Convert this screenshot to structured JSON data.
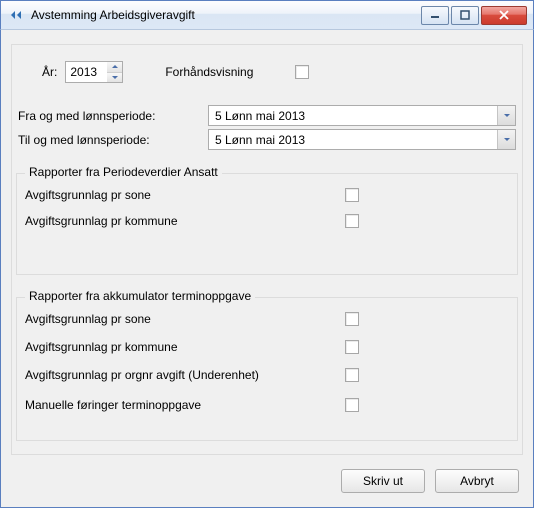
{
  "window": {
    "title": "Avstemming Arbeidsgiveravgift"
  },
  "top": {
    "year_label": "År:",
    "year_value": "2013",
    "preview_label": "Forhåndsvisning"
  },
  "period": {
    "from_label": "Fra og med lønnsperiode:",
    "to_label": "Til og med lønnsperiode:",
    "from_value": "5  Lønn mai 2013",
    "to_value": "5  Lønn mai 2013"
  },
  "group1": {
    "legend": "Rapporter fra Periodeverdier Ansatt",
    "row0": "Avgiftsgrunnlag pr sone",
    "row1": "Avgiftsgrunnlag pr kommune"
  },
  "group2": {
    "legend": "Rapporter fra akkumulator terminoppgave",
    "row0": "Avgiftsgrunnlag pr sone",
    "row1": "Avgiftsgrunnlag pr kommune",
    "row2": "Avgiftsgrunnlag pr orgnr avgift (Underenhet)",
    "row3": "Manuelle føringer terminoppgave"
  },
  "buttons": {
    "print": "Skriv ut",
    "cancel": "Avbryt"
  }
}
